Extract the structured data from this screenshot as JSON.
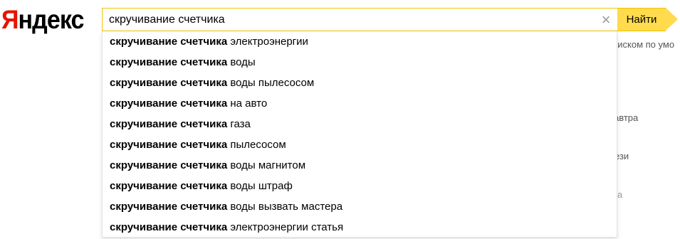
{
  "logo": {
    "first": "Я",
    "rest": "ндекс"
  },
  "search": {
    "value": "скручивание счетчика",
    "clear_icon": "close-icon"
  },
  "find_button": {
    "label": "Найти"
  },
  "suggestions": [
    {
      "query": "скручивание счетчика",
      "completion": "электроэнергии"
    },
    {
      "query": "скручивание счетчика",
      "completion": "воды"
    },
    {
      "query": "скручивание счетчика",
      "completion": "воды пылесосом"
    },
    {
      "query": "скручивание счетчика",
      "completion": "на авто"
    },
    {
      "query": "скручивание счетчика",
      "completion": "газа"
    },
    {
      "query": "скручивание счетчика",
      "completion": "пылесосом"
    },
    {
      "query": "скручивание счетчика",
      "completion": "воды магнитом"
    },
    {
      "query": "скручивание счетчика",
      "completion": "воды штраф"
    },
    {
      "query": "скручивание счетчика",
      "completion": "воды вызвать мастера"
    },
    {
      "query": "скручивание счетчика",
      "completion": "электроэнергии статья"
    }
  ],
  "background": {
    "line1": "поиском по умо",
    "line2": "автра",
    "line3": "ези",
    "line4": "а"
  },
  "colors": {
    "accent": "#ffdb4d",
    "logo_red": "#e61400",
    "border": "#f2c400"
  }
}
